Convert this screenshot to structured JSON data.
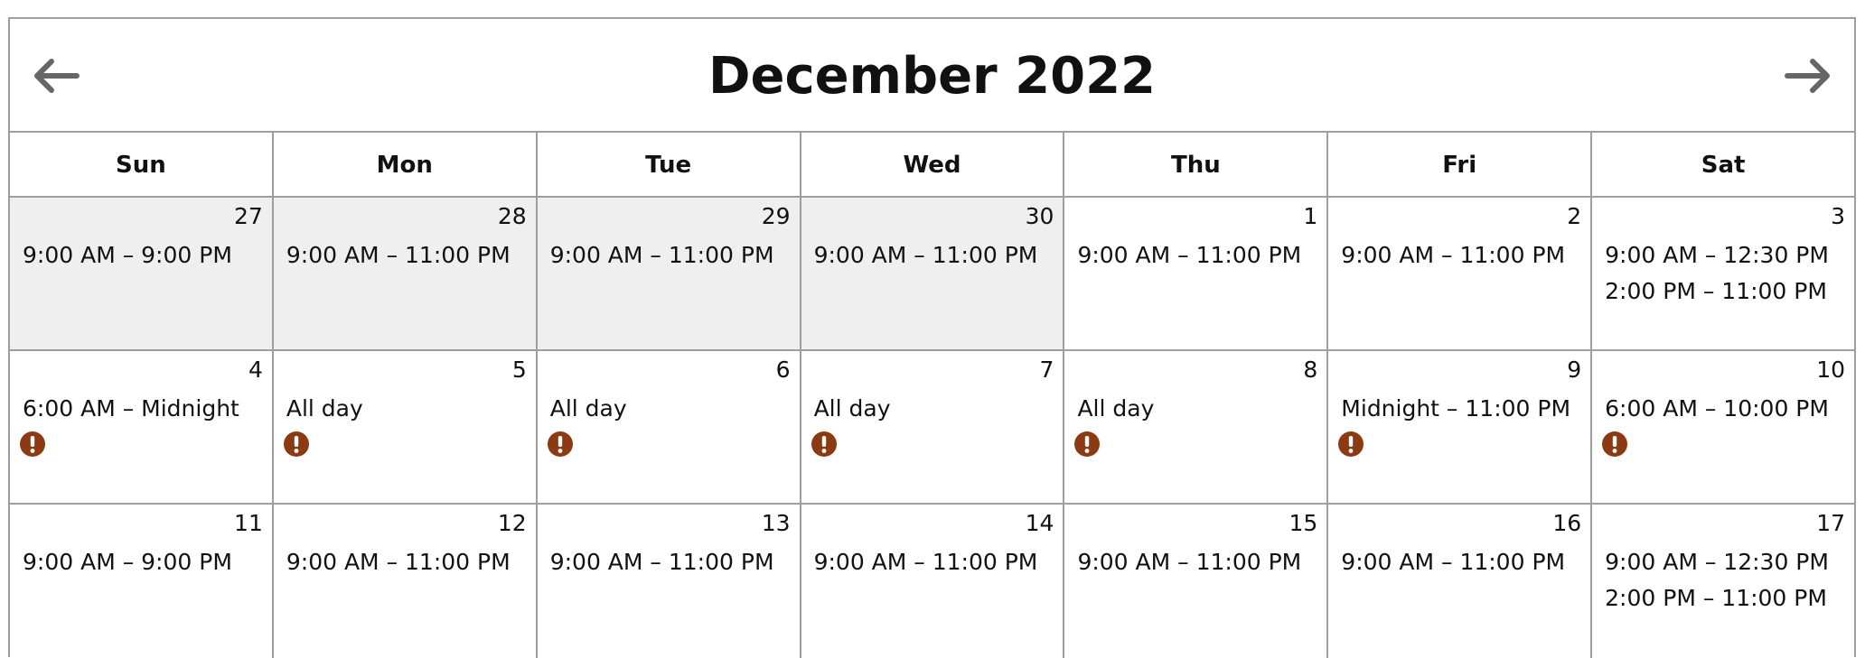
{
  "header": {
    "title": "December 2022",
    "prev_icon": "arrow-left-icon",
    "next_icon": "arrow-right-icon"
  },
  "colors": {
    "border": "#9e9e9e",
    "past_bg": "#efefef",
    "alert": "#8b3a12",
    "arrow": "#666666"
  },
  "weekdays": [
    "Sun",
    "Mon",
    "Tue",
    "Wed",
    "Thu",
    "Fri",
    "Sat"
  ],
  "weeks": [
    [
      {
        "day": "27",
        "slots": [
          "9:00 AM – 9:00 PM"
        ],
        "past": true,
        "alert": false
      },
      {
        "day": "28",
        "slots": [
          "9:00 AM – 11:00 PM"
        ],
        "past": true,
        "alert": false
      },
      {
        "day": "29",
        "slots": [
          "9:00 AM – 11:00 PM"
        ],
        "past": true,
        "alert": false
      },
      {
        "day": "30",
        "slots": [
          "9:00 AM – 11:00 PM"
        ],
        "past": true,
        "alert": false
      },
      {
        "day": "1",
        "slots": [
          "9:00 AM – 11:00 PM"
        ],
        "past": false,
        "alert": false
      },
      {
        "day": "2",
        "slots": [
          "9:00 AM – 11:00 PM"
        ],
        "past": false,
        "alert": false
      },
      {
        "day": "3",
        "slots": [
          "9:00 AM – 12:30 PM",
          "2:00 PM – 11:00 PM"
        ],
        "past": false,
        "alert": false
      }
    ],
    [
      {
        "day": "4",
        "slots": [
          "6:00 AM – Midnight"
        ],
        "past": false,
        "alert": true
      },
      {
        "day": "5",
        "slots": [
          "All day"
        ],
        "past": false,
        "alert": true
      },
      {
        "day": "6",
        "slots": [
          "All day"
        ],
        "past": false,
        "alert": true
      },
      {
        "day": "7",
        "slots": [
          "All day"
        ],
        "past": false,
        "alert": true
      },
      {
        "day": "8",
        "slots": [
          "All day"
        ],
        "past": false,
        "alert": true
      },
      {
        "day": "9",
        "slots": [
          "Midnight – 11:00 PM"
        ],
        "past": false,
        "alert": true
      },
      {
        "day": "10",
        "slots": [
          "6:00 AM – 10:00 PM"
        ],
        "past": false,
        "alert": true
      }
    ],
    [
      {
        "day": "11",
        "slots": [
          "9:00 AM – 9:00 PM"
        ],
        "past": false,
        "alert": false
      },
      {
        "day": "12",
        "slots": [
          "9:00 AM – 11:00 PM"
        ],
        "past": false,
        "alert": false
      },
      {
        "day": "13",
        "slots": [
          "9:00 AM – 11:00 PM"
        ],
        "past": false,
        "alert": false
      },
      {
        "day": "14",
        "slots": [
          "9:00 AM – 11:00 PM"
        ],
        "past": false,
        "alert": false
      },
      {
        "day": "15",
        "slots": [
          "9:00 AM – 11:00 PM"
        ],
        "past": false,
        "alert": false
      },
      {
        "day": "16",
        "slots": [
          "9:00 AM – 11:00 PM"
        ],
        "past": false,
        "alert": false
      },
      {
        "day": "17",
        "slots": [
          "9:00 AM – 12:30 PM",
          "2:00 PM – 11:00 PM"
        ],
        "past": false,
        "alert": false
      }
    ]
  ]
}
